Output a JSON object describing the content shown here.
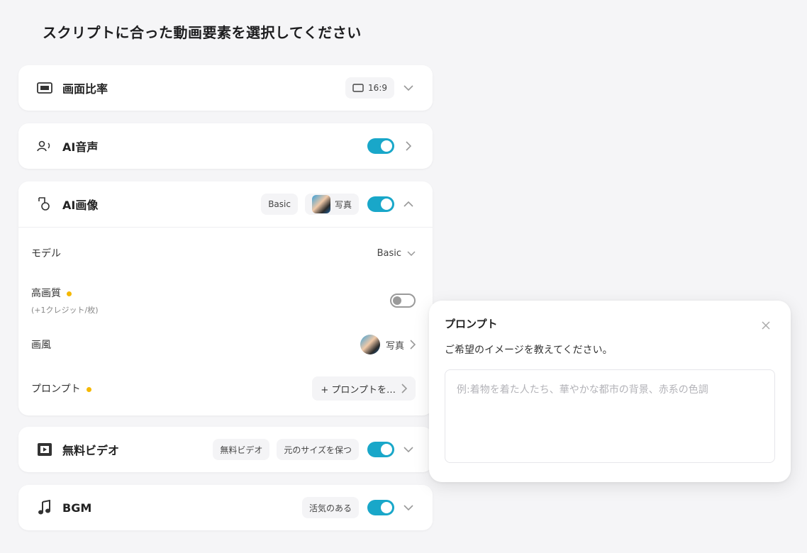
{
  "page": {
    "title": "スクリプトに合った動画要素を選択してください"
  },
  "aspect_ratio": {
    "label": "画面比率",
    "value": "16:9",
    "icon": "aspect-ratio-icon"
  },
  "ai_voice": {
    "label": "AI音声",
    "enabled": true,
    "icon": "voice-icon"
  },
  "ai_image": {
    "label": "AI画像",
    "model_chip": "Basic",
    "style_chip": "写真",
    "enabled": true,
    "icon": "ai-image-icon",
    "model": {
      "label": "モデル",
      "value": "Basic"
    },
    "hq": {
      "label": "高画質",
      "sub": "(+1クレジット/枚)",
      "enabled": false
    },
    "style": {
      "label": "画風",
      "value": "写真"
    },
    "prompt": {
      "label": "プロンプト",
      "value": "+ プロンプトを…"
    }
  },
  "free_video": {
    "label": "無料ビデオ",
    "chip1": "無料ビデオ",
    "chip2": "元のサイズを保つ",
    "enabled": true,
    "icon": "video-icon"
  },
  "bgm": {
    "label": "BGM",
    "chip": "活気のある",
    "enabled": true,
    "icon": "music-note-icon"
  },
  "prompt_popover": {
    "title": "プロンプト",
    "description": "ご希望のイメージを教えてください。",
    "placeholder": "例:着物を着た人たち、華やかな都市の背景、赤系の色調"
  },
  "colors": {
    "accent": "#19a7c9",
    "badge": "#f5b800"
  }
}
